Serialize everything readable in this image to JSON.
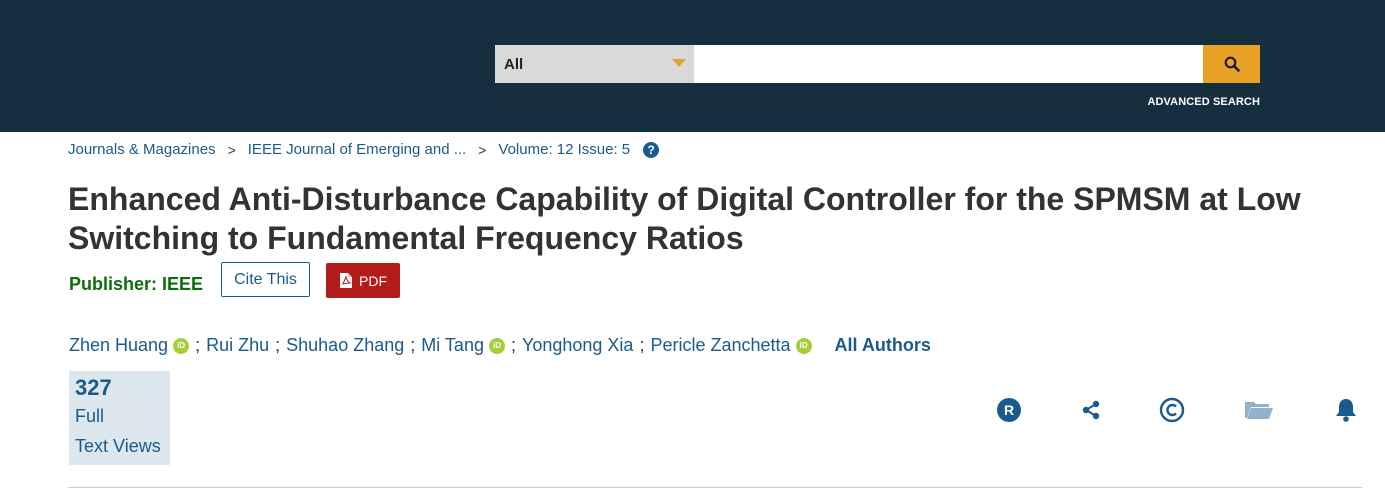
{
  "header": {
    "search_scope": "All",
    "search_placeholder": "",
    "advanced_search": "ADVANCED SEARCH"
  },
  "breadcrumb": {
    "items": [
      "Journals & Magazines",
      "IEEE Journal of Emerging and ...",
      "Volume: 12 Issue: 5"
    ],
    "separator": ">"
  },
  "article": {
    "title": "Enhanced Anti-Disturbance Capability of Digital Controller for the SPMSM at Low Switching to Fundamental Frequency Ratios",
    "publisher_label": "Publisher:",
    "publisher_value": "IEEE",
    "cite_label": "Cite This",
    "pdf_label": "PDF"
  },
  "authors": {
    "list": [
      "Zhen Huang",
      "Rui Zhu",
      "Shuhao Zhang",
      "Mi Tang",
      "Yonghong Xia",
      "Pericle Zanchetta"
    ],
    "separator": ";",
    "all_authors": "All Authors"
  },
  "metrics": {
    "count": "327",
    "label_line1": "Full",
    "label_line2": "Text Views"
  },
  "tools": [
    "rights-icon",
    "share-icon",
    "copyright-icon",
    "folder-icon",
    "bell-icon"
  ],
  "colors": {
    "header_bg": "#162f3f",
    "accent": "#e8a326",
    "link": "#1a5a8c",
    "publisher": "#0b6f0b",
    "pdf": "#b31b1b",
    "orcid": "#a6ce39"
  }
}
